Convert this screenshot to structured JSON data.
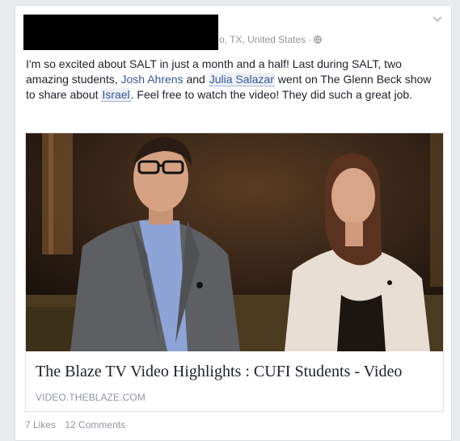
{
  "post": {
    "location": "o, TX, United States",
    "separator": "·",
    "text_part1": "I'm so excited about SALT in just a month and a half! Last during SALT, two amazing students, ",
    "mention_1": "Josh Ahrens",
    "text_part2": " and ",
    "mention_2": "Julia Salazar",
    "text_part3": " went on The Glenn Beck show to share about ",
    "mention_3": "Israel",
    "text_part4": ". Feel free to watch the video! They did such a great job."
  },
  "link": {
    "title": "The Blaze TV Video Highlights : CUFI Students - Video",
    "domain": "VIDEO.THEBLAZE.COM"
  },
  "footer": {
    "likes": "7 Likes",
    "comments": "12 Comments"
  },
  "icons": {
    "privacy": "globe-icon",
    "menu": "chevron-down-icon"
  },
  "colors": {
    "link_blue": "#365899",
    "meta_gray": "#90949c",
    "text": "#1d2129"
  }
}
